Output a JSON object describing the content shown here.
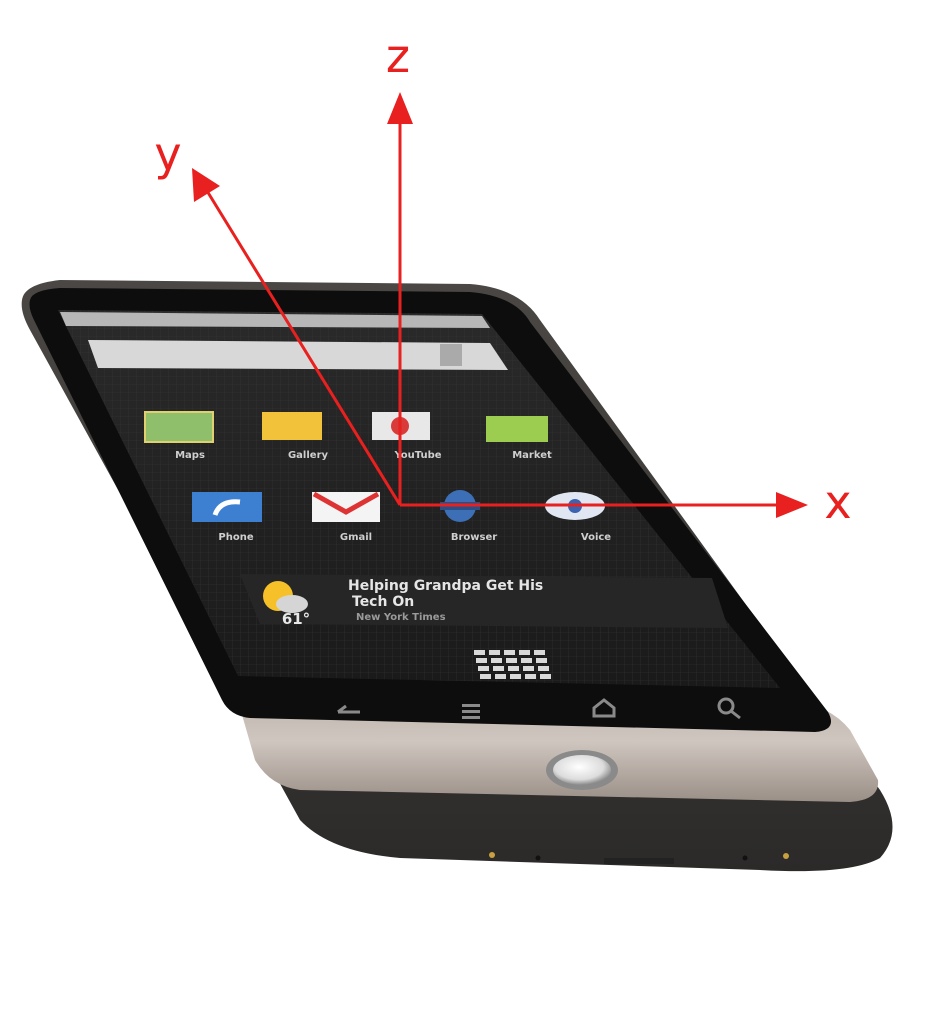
{
  "axes": {
    "x_label": "x",
    "y_label": "y",
    "z_label": "z",
    "color": "#e8201f"
  },
  "phone": {
    "apps_row1": [
      "Maps",
      "Gallery",
      "YouTube",
      "Market"
    ],
    "apps_row2": [
      "Phone",
      "Gmail",
      "Browser",
      "Voice"
    ],
    "weather_temp": "61°",
    "news_headline_1": "Helping Grandpa Get His",
    "news_headline_2": "Tech On",
    "news_source": "New York Times",
    "icons": [
      "back-icon",
      "menu-icon",
      "home-icon",
      "search-icon",
      "launcher-grid-icon",
      "trackball-icon"
    ]
  }
}
